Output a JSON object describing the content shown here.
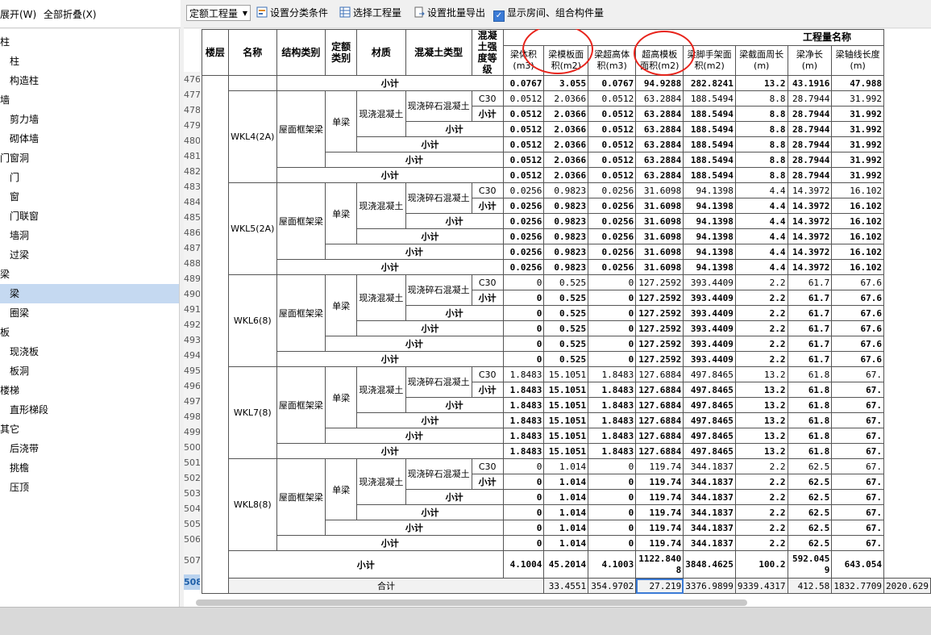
{
  "left_toolbar": {
    "expand_label": "展开(W)",
    "collapse_label": "全部折叠(X)"
  },
  "tree": [
    {
      "label": "柱",
      "level": 0,
      "selected": false
    },
    {
      "label": "柱",
      "level": 1,
      "selected": false
    },
    {
      "label": "构造柱",
      "level": 1,
      "selected": false
    },
    {
      "label": "墙",
      "level": 0,
      "selected": false
    },
    {
      "label": "剪力墙",
      "level": 1,
      "selected": false
    },
    {
      "label": "砌体墙",
      "level": 1,
      "selected": false
    },
    {
      "label": "门窗洞",
      "level": 0,
      "selected": false
    },
    {
      "label": "门",
      "level": 1,
      "selected": false
    },
    {
      "label": "窗",
      "level": 1,
      "selected": false
    },
    {
      "label": "门联窗",
      "level": 1,
      "selected": false
    },
    {
      "label": "墙洞",
      "level": 1,
      "selected": false
    },
    {
      "label": "过梁",
      "level": 1,
      "selected": false
    },
    {
      "label": "梁",
      "level": 0,
      "selected": false
    },
    {
      "label": "梁",
      "level": 1,
      "selected": true
    },
    {
      "label": "圈梁",
      "level": 1,
      "selected": false
    },
    {
      "label": "板",
      "level": 0,
      "selected": false
    },
    {
      "label": "现浇板",
      "level": 1,
      "selected": false
    },
    {
      "label": "板洞",
      "level": 1,
      "selected": false
    },
    {
      "label": "楼梯",
      "level": 0,
      "selected": false
    },
    {
      "label": "直形梯段",
      "level": 1,
      "selected": false
    },
    {
      "label": "其它",
      "level": 0,
      "selected": false
    },
    {
      "label": "后浇带",
      "level": 1,
      "selected": false
    },
    {
      "label": "挑檐",
      "level": 1,
      "selected": false
    },
    {
      "label": "压顶",
      "level": 1,
      "selected": false
    }
  ],
  "toolbar": {
    "combo_value": "定额工程量",
    "set_category": "设置分类条件",
    "select_quantity": "选择工程量",
    "batch_export": "设置批量导出",
    "show_rooms": "显示房间、组合构件量"
  },
  "headers": {
    "floor": "楼层",
    "name": "名称",
    "struct_type": "结构类别",
    "quota_type": "定额类别",
    "material": "材质",
    "concrete_type": "混凝土类型",
    "concrete_grade": "混凝土强度等级",
    "group": "工程量名称",
    "c1": "梁体积(m3)",
    "c2": "梁模板面积(m2)",
    "c3": "梁超高体积(m3)",
    "c4": "超高模板面积(m2)",
    "c5": "梁脚手架面积(m2)",
    "c6": "梁截面周长(m)",
    "c7": "梁净长(m)",
    "c8": "梁轴线长度(m)"
  },
  "labels": {
    "subtotal": "小计",
    "total": "合计"
  },
  "groups": [
    {
      "name": "WKL4(2A)",
      "struct": "屋面框架梁",
      "quota": "单梁",
      "material": "现浇混凝土",
      "ctype": "现浇碎石混凝土",
      "grade": "C30",
      "v": [
        "0.0512",
        "2.0366",
        "0.0512",
        "63.2884",
        "188.5494",
        "8.8",
        "28.7944",
        "31.992"
      ]
    },
    {
      "name": "WKL5(2A)",
      "struct": "屋面框架梁",
      "quota": "单梁",
      "material": "现浇混凝土",
      "ctype": "现浇碎石混凝土",
      "grade": "C30",
      "v": [
        "0.0256",
        "0.9823",
        "0.0256",
        "31.6098",
        "94.1398",
        "4.4",
        "14.3972",
        "16.102"
      ]
    },
    {
      "name": "WKL6(8)",
      "struct": "屋面框架梁",
      "quota": "单梁",
      "material": "现浇混凝土",
      "ctype": "现浇碎石混凝土",
      "grade": "C30",
      "v": [
        "0",
        "0.525",
        "0",
        "127.2592",
        "393.4409",
        "2.2",
        "61.7",
        "67.6"
      ]
    },
    {
      "name": "WKL7(8)",
      "struct": "屋面框架梁",
      "quota": "单梁",
      "material": "现浇混凝土",
      "ctype": "现浇碎石混凝土",
      "grade": "C30",
      "v": [
        "1.8483",
        "15.1051",
        "1.8483",
        "127.6884",
        "497.8465",
        "13.2",
        "61.8",
        "67."
      ]
    },
    {
      "name": "WKL8(8)",
      "struct": "屋面框架梁",
      "quota": "单梁",
      "material": "现浇混凝土",
      "ctype": "现浇碎石混凝土",
      "grade": "C30",
      "v": [
        "0",
        "1.014",
        "0",
        "119.74",
        "344.1837",
        "2.2",
        "62.5",
        "67."
      ]
    }
  ],
  "first_row": {
    "v": [
      "0.0767",
      "3.055",
      "0.0767",
      "94.9288",
      "282.8241",
      "13.2",
      "43.1916",
      "47.988"
    ]
  },
  "floor_subtotal": {
    "v": [
      "4.1004",
      "45.2014",
      "4.1003",
      "1122.8408",
      "3848.4625",
      "100.2",
      "592.0459",
      "643.054"
    ]
  },
  "grand_total": {
    "v": [
      "33.4551",
      "354.9702",
      "27.219",
      "3376.9899",
      "9339.4317",
      "412.58",
      "1832.7709",
      "2020.629"
    ]
  },
  "row_numbers": {
    "start": 476,
    "end": 508,
    "active": 508
  }
}
